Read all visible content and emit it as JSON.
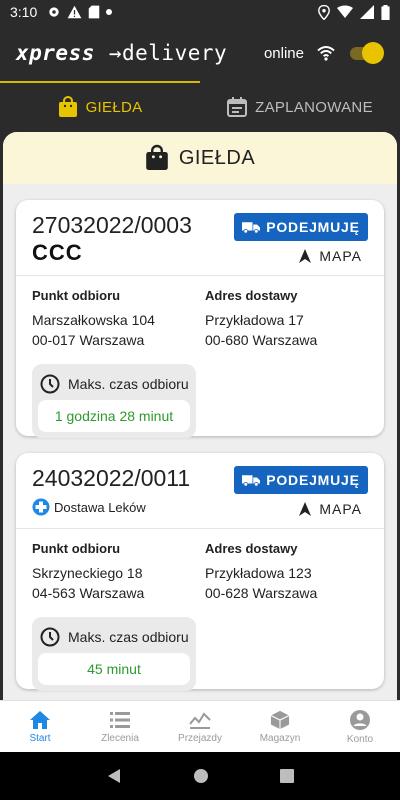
{
  "status_bar": {
    "time": "3:10",
    "left_icons": [
      "gear-icon",
      "warning-icon",
      "sd-card-icon",
      "dot-icon"
    ],
    "right_icons": [
      "location-icon",
      "wifi-icon",
      "signal-icon",
      "battery-icon"
    ]
  },
  "app_bar": {
    "logo_left": "xpress",
    "logo_right": "→delivery",
    "online_label": "online",
    "online_toggle": true,
    "accent_color": "#e8c400"
  },
  "tabs": [
    {
      "label": "GIEŁDA",
      "icon": "bag-icon",
      "active": true
    },
    {
      "label": "ZAPLANOWANE",
      "icon": "calendar-icon",
      "active": false
    }
  ],
  "section": {
    "title": "GIEŁDA",
    "icon": "bag-icon"
  },
  "orders": [
    {
      "order_number": "27032022/0003",
      "client": "CCC",
      "take_label": "PODEJMUJĘ",
      "map_label": "MAPA",
      "pickup_label": "Punkt odbioru",
      "pickup_street": "Marszałkowska 104",
      "pickup_city": "00-017 Warszawa",
      "delivery_label": "Adres dostawy",
      "delivery_street": "Przykładowa 17",
      "delivery_city": "00-680 Warszawa",
      "time_label": "Maks. czas odbioru",
      "time_value": "1 godzina 28 minut"
    },
    {
      "order_number": "24032022/0011",
      "client": "Dostawa Leków",
      "take_label": "PODEJMUJĘ",
      "map_label": "MAPA",
      "pickup_label": "Punkt odbioru",
      "pickup_street": "Skrzyneckiego 18",
      "pickup_city": "04-563 Warszawa",
      "delivery_label": "Adres dostawy",
      "delivery_street": "Przykładowa 123",
      "delivery_city": "00-628 Warszawa",
      "time_label": "Maks. czas odbioru",
      "time_value": "45 minut"
    }
  ],
  "bottom_nav": [
    {
      "label": "Start",
      "icon": "home-icon",
      "active": true
    },
    {
      "label": "Zlecenia",
      "icon": "list-icon",
      "active": false
    },
    {
      "label": "Przejazdy",
      "icon": "chart-icon",
      "active": false
    },
    {
      "label": "Magazyn",
      "icon": "box-icon",
      "active": false
    },
    {
      "label": "Konto",
      "icon": "account-icon",
      "active": false
    }
  ]
}
